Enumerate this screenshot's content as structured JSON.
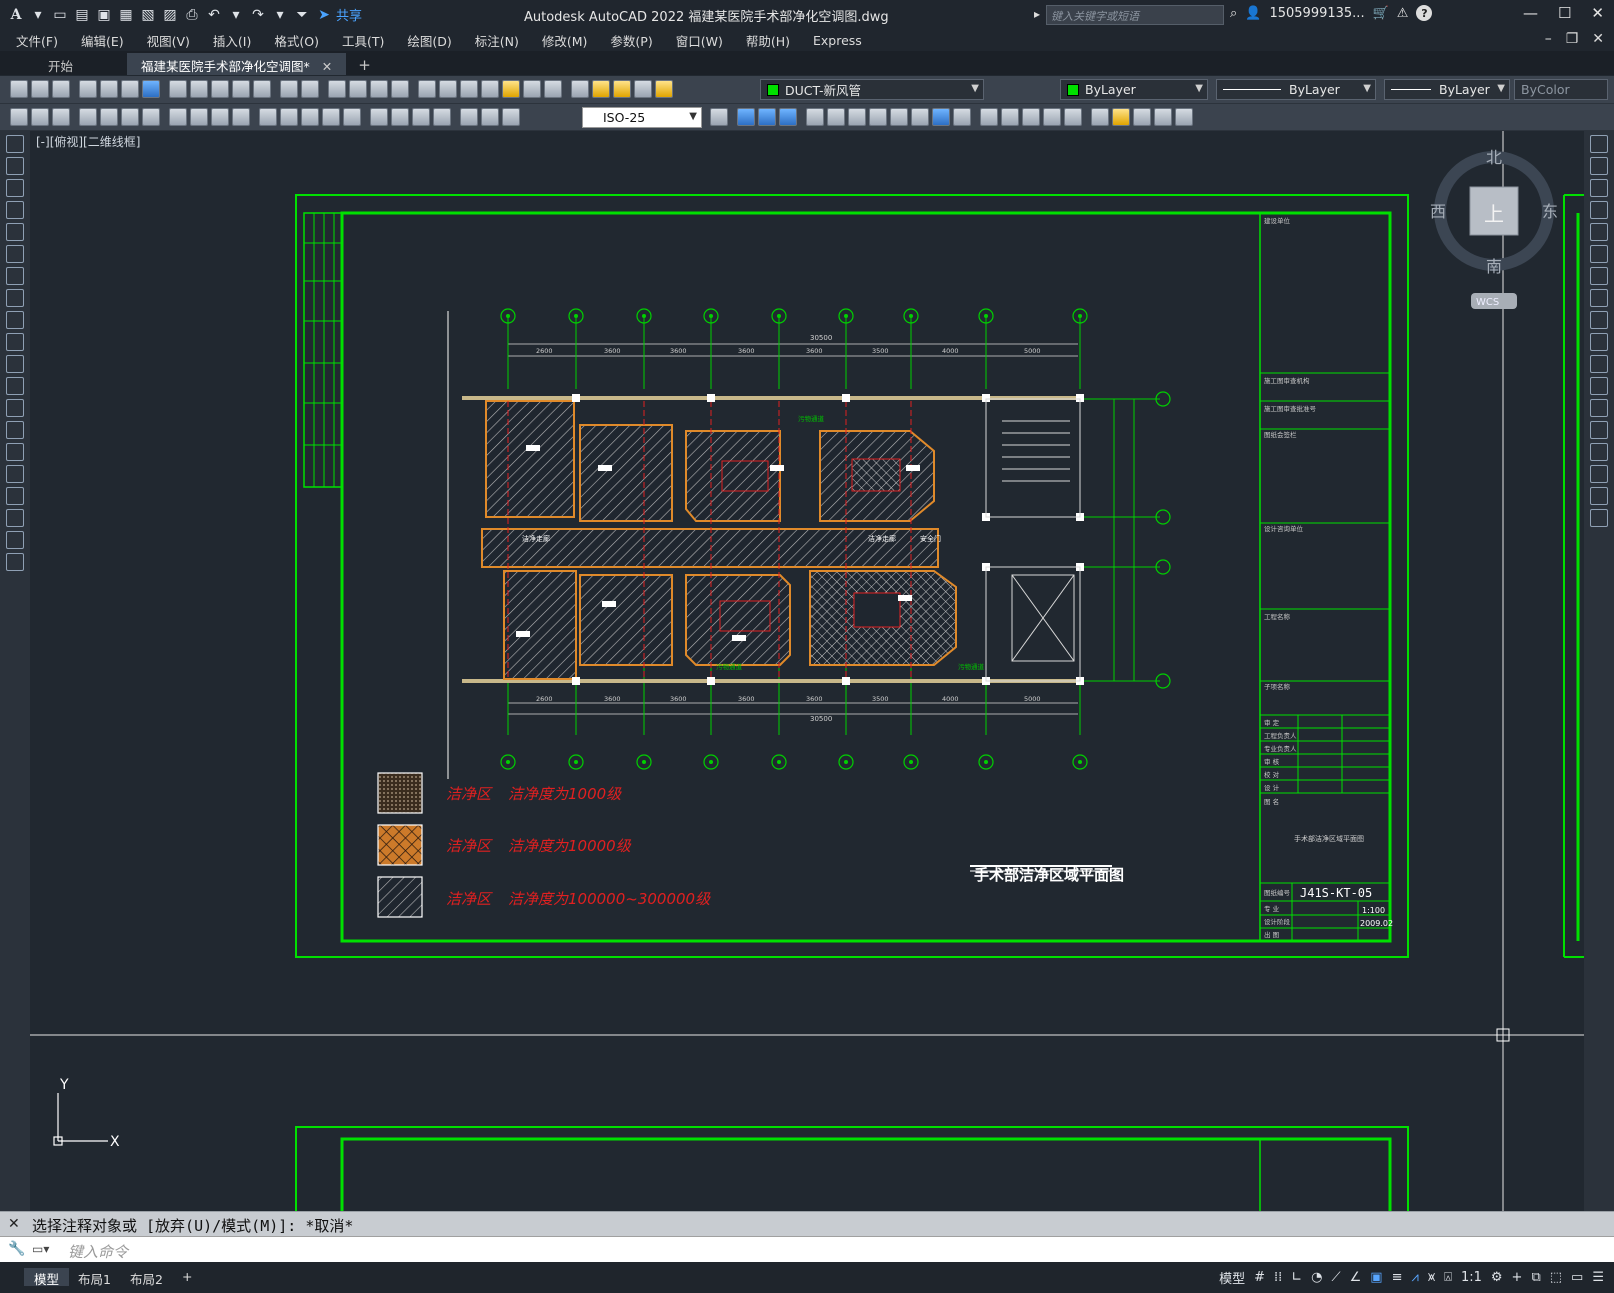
{
  "app": {
    "title": "Autodesk AutoCAD 2022    福建某医院手术部净化空调图.dwg",
    "logo": "A",
    "share_label": "共享",
    "search_placeholder": "键入关键字或短语",
    "user": "1505999135...",
    "help": "?"
  },
  "menu": [
    "文件(F)",
    "编辑(E)",
    "视图(V)",
    "插入(I)",
    "格式(O)",
    "工具(T)",
    "绘图(D)",
    "标注(N)",
    "修改(M)",
    "参数(P)",
    "窗口(W)",
    "帮助(H)",
    "Express"
  ],
  "tabs": {
    "start": "开始",
    "doc": "福建某医院手术部净化空调图*",
    "add": "+"
  },
  "toolbar": {
    "layer": "DUCT-新风管",
    "color": "ByLayer",
    "linetype": "ByLayer",
    "lineweight": "ByLayer",
    "plotstyle": "ByColor",
    "dimstyle": "ISO-25"
  },
  "viewport": {
    "label": "[-][俯视][二维线框]",
    "compass": {
      "n": "北",
      "s": "南",
      "e": "东",
      "w": "西",
      "top": "上",
      "wcs": "WCS"
    },
    "ucs": {
      "x": "X",
      "y": "Y"
    }
  },
  "drawing": {
    "title": "手术部洁净区域平面图",
    "legend": [
      {
        "zone": "洁净区",
        "desc": "洁净度为1000级"
      },
      {
        "zone": "洁净区",
        "desc": "洁净度为10000级"
      },
      {
        "zone": "洁净区",
        "desc": "洁净度为100000~300000级"
      }
    ],
    "drawing_no": "J41S-KT-05",
    "scale": "1:100",
    "date": "2009.02",
    "sheet_name": "手术部洁净区域平面图",
    "dims_top": [
      "2600",
      "3600",
      "3600",
      "3600",
      "3600",
      "3500",
      "4000",
      "5000"
    ],
    "total_dim": "30500",
    "room_labels": {
      "corridor1": "洁净走廊",
      "corridor2": "洁净走廊",
      "dirty1": "污物通道",
      "dirty2": "污物通道",
      "dirty3": "污物通道",
      "safety": "安全门"
    }
  },
  "command": {
    "history": "选择注释对象或 [放弃(U)/模式(M)]: *取消*",
    "placeholder": "键入命令"
  },
  "layouts": [
    "模型",
    "布局1",
    "布局2",
    "+"
  ],
  "status": {
    "model": "模型",
    "scale": "1:1"
  }
}
